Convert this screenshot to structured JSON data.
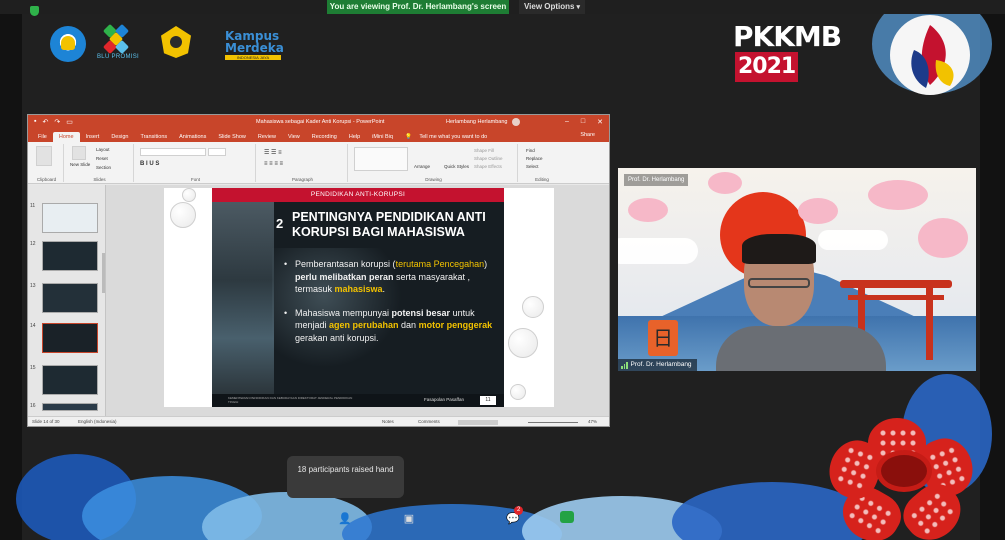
{
  "zoom": {
    "viewing_banner": "You are viewing Prof. Dr. Herlambang's screen",
    "view_options": "View Options",
    "raised_hands": "18 participants raised hand",
    "chat_badge": "2"
  },
  "header": {
    "promisi_label": "BLU PROMISI",
    "kampus_line1": "Kampus",
    "kampus_line2": "Merdeka",
    "kampus_line3": "INDONESIA JAYA",
    "event_main": "PKKMB",
    "event_year": "2021"
  },
  "powerpoint": {
    "doc_title": "Mahasiswa sebagai Kader Anti Korupsi - PowerPoint",
    "user": "Herlambang Herlambang",
    "menu": [
      "File",
      "Home",
      "Insert",
      "Design",
      "Transitions",
      "Animations",
      "Slide Show",
      "Review",
      "View",
      "Recording",
      "Help",
      "iMini Biq"
    ],
    "tell_me": "Tell me what you want to do",
    "share": "Share",
    "ribbon": {
      "groups": [
        "Clipboard",
        "Slides",
        "Font",
        "Paragraph",
        "Drawing",
        "Editing"
      ],
      "new_slide": "New Slide",
      "layout": "Layout",
      "reset": "Reset",
      "section": "Section",
      "arrange": "Arrange",
      "quick_styles": "Quick Styles",
      "shape_fill": "Shape Fill",
      "shape_outline": "Shape Outline",
      "shape_effects": "Shape Effects",
      "find": "Find",
      "replace": "Replace",
      "select": "Select"
    },
    "thumbnails": [
      "11",
      "12",
      "13",
      "14",
      "15",
      "16"
    ],
    "selected_thumb": "14",
    "status_slide": "Slide 14 of 30",
    "status_lang": "English (Indonesia)",
    "status_notes": "Notes",
    "status_comments": "Comments",
    "zoom_level": "47%"
  },
  "slide": {
    "banner": "PENDIDIKAN ANTI-KORUPSI",
    "number": "2",
    "title": "PENTINGNYA PENDIDIKAN ANTI KORUPSI BAGI MAHASISWA",
    "bullet1_a": "Pemberantasan korupsi (",
    "bullet1_b": "terutama Pencegahan",
    "bullet1_c": ") ",
    "bullet1_d": "perlu melibatkan peran",
    "bullet1_e": " serta  masyarakat , termasuk ",
    "bullet1_f": "mahasiswa",
    "bullet1_g": ".",
    "bullet2_a": "Mahasiswa mempunyai ",
    "bullet2_b": "potensi besar",
    "bullet2_c": " untuk menjadi ",
    "bullet2_d": "agen perubahan",
    "bullet2_e": " dan ",
    "bullet2_f": "motor penggerak",
    "bullet2_g": " gerakan anti korupsi.",
    "footer_text": "KEMENTERIAN PENDIDIKAN DAN KEBUDAYAAN DIREKTORAT JENDERAL PENDIDIKAN TINGGI",
    "footer_presenter": "Fasapolan Pasaffan",
    "page": "11"
  },
  "video": {
    "top_label": "Prof. Dr. Herlambang",
    "name": "Prof. Dr. Herlambang",
    "kanji": "日"
  },
  "colors": {
    "ppt_accent": "#c8452a",
    "slide_banner": "#c4122f",
    "highlight": "#f2c200",
    "zoom_green": "#1e7d34"
  }
}
